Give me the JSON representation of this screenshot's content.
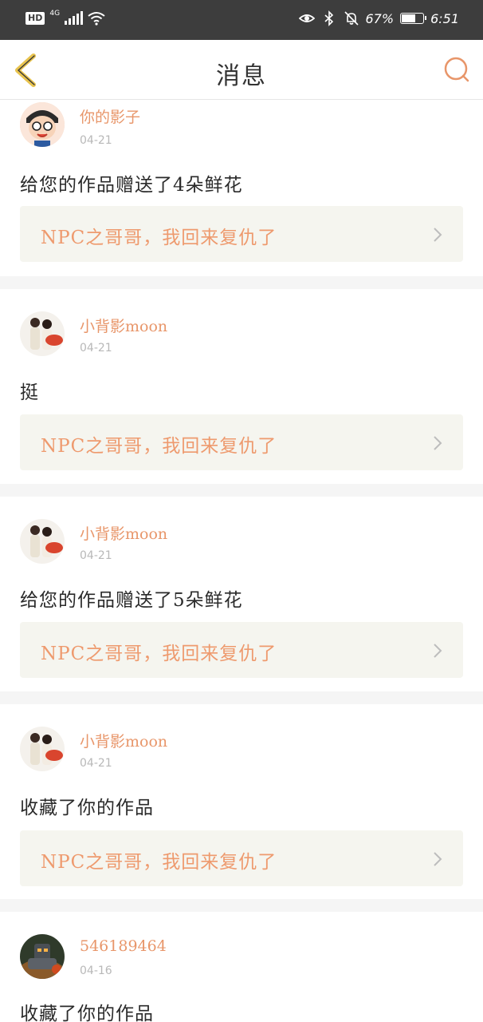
{
  "status_bar": {
    "hd": "HD",
    "network": "4G",
    "battery_text": "67%",
    "battery_level": 0.67,
    "time": "6:51"
  },
  "header": {
    "title": "消息",
    "back_icon": "chevron-left-icon",
    "search_icon": "search-icon"
  },
  "colors": {
    "accent": "#e8966a",
    "back_arrow": "#e8c34e",
    "card_bg": "#f5f5ef",
    "date": "#b8b8b8",
    "status_bar": "#3d3d3d"
  },
  "messages": [
    {
      "username": "你的影子",
      "date": "04-21",
      "text": "给您的作品赠送了4朵鲜花",
      "work_title": "NPC之哥哥，我回来复仇了",
      "avatar": "cartoon-boy-avatar"
    },
    {
      "username": "小背影moon",
      "date": "04-21",
      "text": "挺",
      "work_title": "NPC之哥哥，我回来复仇了",
      "avatar": "couple-photo-avatar"
    },
    {
      "username": "小背影moon",
      "date": "04-21",
      "text": "给您的作品赠送了5朵鲜花",
      "work_title": "NPC之哥哥，我回来复仇了",
      "avatar": "couple-photo-avatar"
    },
    {
      "username": "小背影moon",
      "date": "04-21",
      "text": "收藏了你的作品",
      "work_title": "NPC之哥哥，我回来复仇了",
      "avatar": "couple-photo-avatar"
    },
    {
      "username": "546189464",
      "date": "04-16",
      "text": "收藏了你的作品",
      "avatar": "robot-game-avatar"
    }
  ]
}
